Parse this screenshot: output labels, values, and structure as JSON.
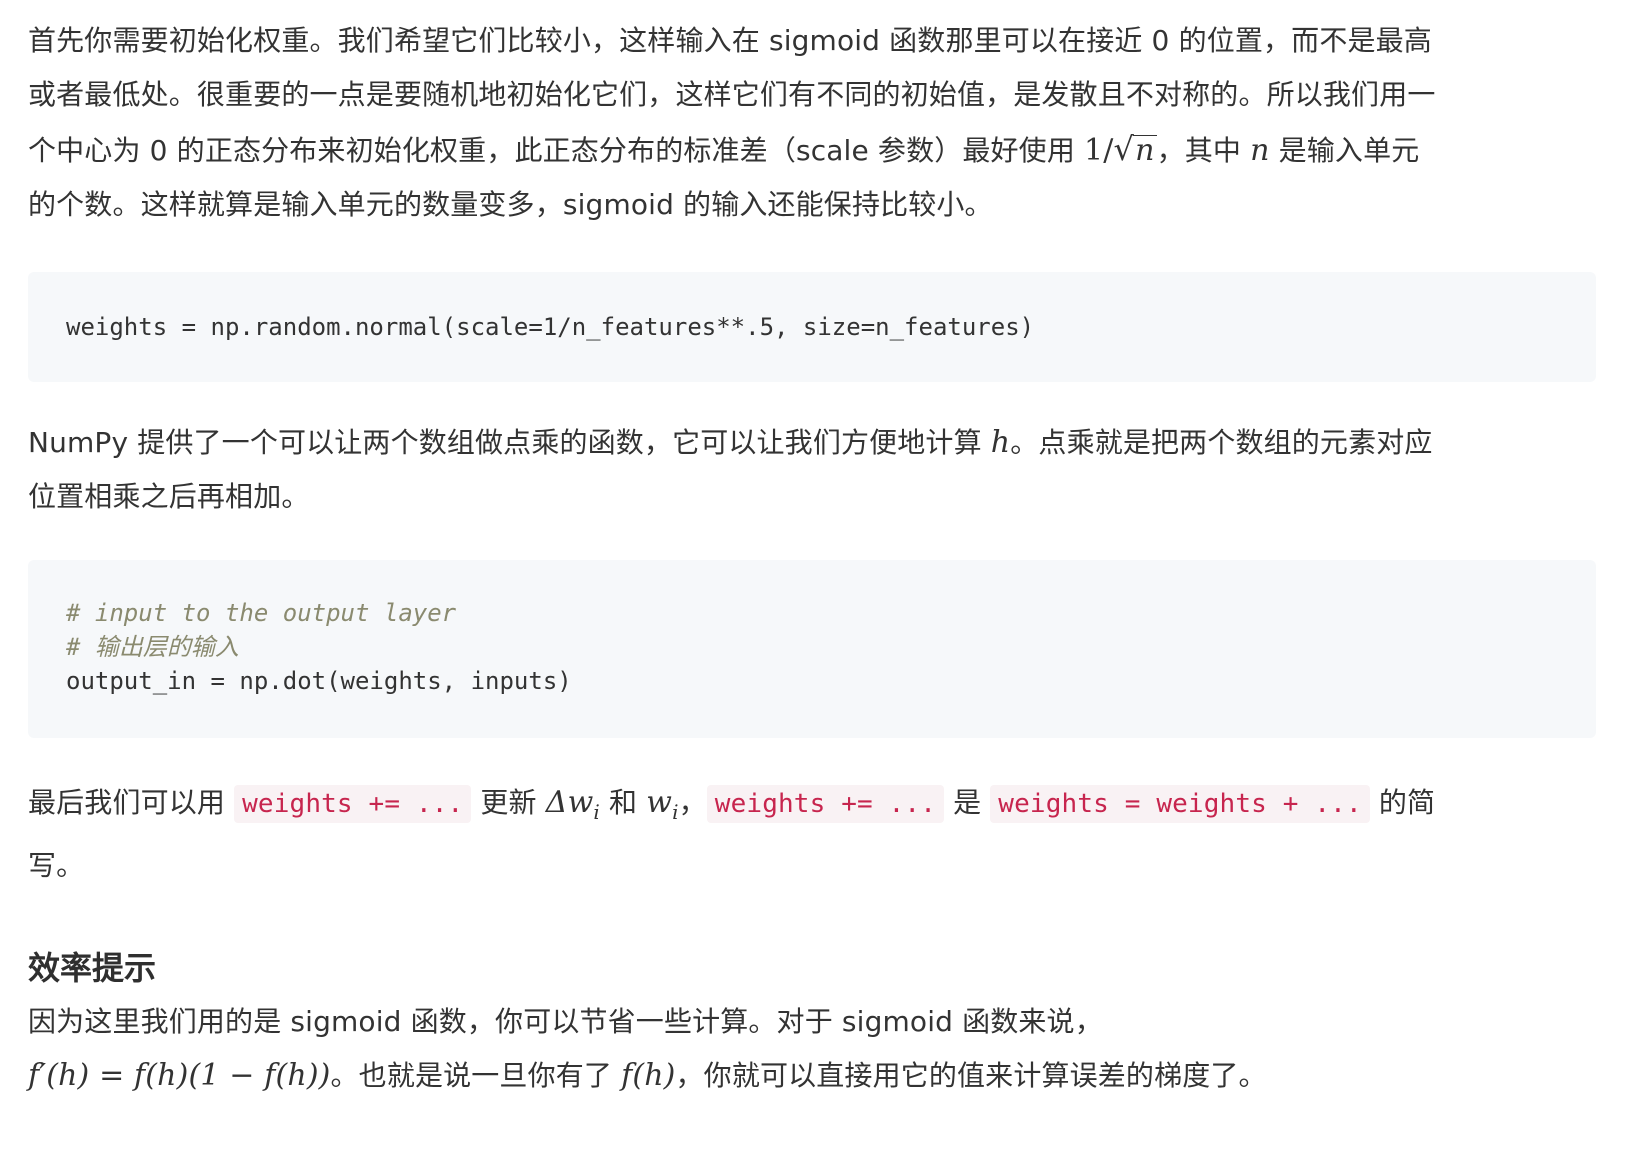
{
  "para1": {
    "line1": "首先你需要初始化权重。我们希望它们比较小，这样输入在 sigmoid 函数那里可以在接近 0 的位置，而不是最高",
    "line2": "或者最低处。很重要的一点是要随机地初始化它们，这样它们有不同的初始值，是发散且不对称的。所以我们用一",
    "line3_a": "个中心为 0 的正态分布来初始化权重，此正态分布的标准差（scale 参数）最好使用 ",
    "line3_math_num": "1/",
    "line3_math_rad": "n",
    "line3_b": "，其中 ",
    "line3_math_n": "n",
    "line3_c": " 是输入单元",
    "line4": "的个数。这样就算是输入单元的数量变多，sigmoid 的输入还能保持比较小。"
  },
  "code1": {
    "line1": "weights = np.random.normal(scale=1/n_features**.5, size=n_features)"
  },
  "para2": {
    "line1_a": "NumPy 提供了一个可以让两个数组做点乘的函数，它可以让我们方便地计算 ",
    "line1_math": "h",
    "line1_b": "。点乘就是把两个数组的元素对应",
    "line2": "位置相乘之后再相加。"
  },
  "code2": {
    "comment1": "# input to the output layer",
    "comment2": "# 输出层的输入",
    "line3": "output_in = np.dot(weights, inputs)"
  },
  "para3": {
    "t1": "最后我们可以用 ",
    "code1": "weights += ...",
    "t2": " 更新 ",
    "math1": "Δw",
    "math1_sub": "i",
    "t3": " 和 ",
    "math2": "w",
    "math2_sub": "i",
    "t4": "，",
    "code2": "weights += ...",
    "t5": " 是 ",
    "code3": "weights = weights + ...",
    "t6": " 的简",
    "line2": "写。"
  },
  "heading": "效率提示",
  "para4": {
    "line1": "因为这里我们用的是 sigmoid 函数，你可以节省一些计算。对于 sigmoid 函数来说，",
    "math1": "f′(h) = f(h)(1 − f(h))",
    "t2": "。也就是说一旦你有了 ",
    "math2": "f(h)",
    "t3": "，你就可以直接用它的值来计算误差的梯度了。"
  }
}
